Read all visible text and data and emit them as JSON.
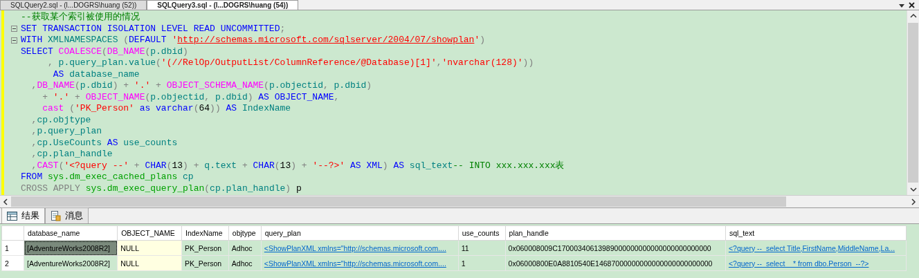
{
  "doc_tabs": [
    {
      "label": "SQLQuery2.sql - (l...DOGRS\\huang (52))",
      "selected": false
    },
    {
      "label": "SQLQuery3.sql - (l...DOGRS\\huang (54))",
      "selected": true
    }
  ],
  "editor": {
    "lines": [
      {
        "fold": false,
        "tokens": [
          {
            "kind": "comment",
            "text": "--获取某个索引被使用的情况"
          }
        ]
      },
      {
        "fold": true,
        "tokens": [
          {
            "kind": "keyword",
            "text": "SET TRANSACTION ISOLATION LEVEL READ UNCOMMITTED"
          },
          {
            "kind": "op",
            "text": ";"
          }
        ]
      },
      {
        "fold": true,
        "tokens": [
          {
            "kind": "keyword",
            "text": "WITH"
          },
          {
            "kind": "ident",
            "text": " XMLNAMESPACES "
          },
          {
            "kind": "op",
            "text": "("
          },
          {
            "kind": "keyword",
            "text": "DEFAULT "
          },
          {
            "kind": "string",
            "text": "'"
          },
          {
            "kind": "link",
            "text": "http://schemas.microsoft.com/sqlserver/2004/07/showplan"
          },
          {
            "kind": "string",
            "text": "'"
          },
          {
            "kind": "op",
            "text": ")"
          }
        ]
      },
      {
        "fold": false,
        "tokens": [
          {
            "kind": "keyword",
            "text": "SELECT "
          },
          {
            "kind": "function",
            "text": "COALESCE"
          },
          {
            "kind": "op",
            "text": "("
          },
          {
            "kind": "function",
            "text": "DB_NAME"
          },
          {
            "kind": "op",
            "text": "("
          },
          {
            "kind": "ident",
            "text": "p.dbid"
          },
          {
            "kind": "op",
            "text": ")"
          }
        ]
      },
      {
        "fold": false,
        "tokens": [
          {
            "kind": "op",
            "text": "     , "
          },
          {
            "kind": "ident",
            "text": "p.query_plan.value"
          },
          {
            "kind": "op",
            "text": "("
          },
          {
            "kind": "string",
            "text": "'(//RelOp/OutputList/ColumnReference/@Database)[1]'"
          },
          {
            "kind": "op",
            "text": ","
          },
          {
            "kind": "string",
            "text": "'nvarchar(128)'"
          },
          {
            "kind": "op",
            "text": "))"
          }
        ]
      },
      {
        "fold": false,
        "tokens": [
          {
            "kind": "keyword",
            "text": "      AS "
          },
          {
            "kind": "ident",
            "text": "database_name"
          }
        ]
      },
      {
        "fold": false,
        "tokens": [
          {
            "kind": "op",
            "text": "  ,"
          },
          {
            "kind": "function",
            "text": "DB_NAME"
          },
          {
            "kind": "op",
            "text": "("
          },
          {
            "kind": "ident",
            "text": "p.dbid"
          },
          {
            "kind": "op",
            "text": ") + "
          },
          {
            "kind": "string",
            "text": "'.'"
          },
          {
            "kind": "op",
            "text": " + "
          },
          {
            "kind": "function",
            "text": "OBJECT_SCHEMA_NAME"
          },
          {
            "kind": "op",
            "text": "("
          },
          {
            "kind": "ident",
            "text": "p.objectid"
          },
          {
            "kind": "op",
            "text": ", "
          },
          {
            "kind": "ident",
            "text": "p.dbid"
          },
          {
            "kind": "op",
            "text": ")"
          }
        ]
      },
      {
        "fold": false,
        "tokens": [
          {
            "kind": "op",
            "text": "    + "
          },
          {
            "kind": "string",
            "text": "'.'"
          },
          {
            "kind": "op",
            "text": " + "
          },
          {
            "kind": "function",
            "text": "OBJECT_NAME"
          },
          {
            "kind": "op",
            "text": "("
          },
          {
            "kind": "ident",
            "text": "p.objectid"
          },
          {
            "kind": "op",
            "text": ", "
          },
          {
            "kind": "ident",
            "text": "p.dbid"
          },
          {
            "kind": "op",
            "text": ") "
          },
          {
            "kind": "keyword",
            "text": "AS OBJECT_NAME"
          },
          {
            "kind": "op",
            "text": ","
          }
        ]
      },
      {
        "fold": false,
        "tokens": [
          {
            "kind": "function",
            "text": "    cast "
          },
          {
            "kind": "op",
            "text": "("
          },
          {
            "kind": "string",
            "text": "'PK_Person'"
          },
          {
            "kind": "keyword",
            "text": " as varchar"
          },
          {
            "kind": "op",
            "text": "("
          },
          {
            "kind": "plain",
            "text": "64"
          },
          {
            "kind": "op",
            "text": ")) "
          },
          {
            "kind": "keyword",
            "text": "AS "
          },
          {
            "kind": "ident",
            "text": "IndexName"
          }
        ]
      },
      {
        "fold": false,
        "tokens": [
          {
            "kind": "op",
            "text": "  ,"
          },
          {
            "kind": "ident",
            "text": "cp.objtype"
          }
        ]
      },
      {
        "fold": false,
        "tokens": [
          {
            "kind": "op",
            "text": "  ,"
          },
          {
            "kind": "ident",
            "text": "p.query_plan"
          }
        ]
      },
      {
        "fold": false,
        "tokens": [
          {
            "kind": "op",
            "text": "  ,"
          },
          {
            "kind": "ident",
            "text": "cp.UseCounts "
          },
          {
            "kind": "keyword",
            "text": "AS "
          },
          {
            "kind": "ident",
            "text": "use_counts"
          }
        ]
      },
      {
        "fold": false,
        "tokens": [
          {
            "kind": "op",
            "text": "  ,"
          },
          {
            "kind": "ident",
            "text": "cp.plan_handle"
          }
        ]
      },
      {
        "fold": false,
        "tokens": [
          {
            "kind": "op",
            "text": "  ,"
          },
          {
            "kind": "function",
            "text": "CAST"
          },
          {
            "kind": "op",
            "text": "("
          },
          {
            "kind": "string",
            "text": "'<?query --'"
          },
          {
            "kind": "op",
            "text": " + "
          },
          {
            "kind": "keyword",
            "text": "CHAR"
          },
          {
            "kind": "op",
            "text": "("
          },
          {
            "kind": "plain",
            "text": "13"
          },
          {
            "kind": "op",
            "text": ") + "
          },
          {
            "kind": "ident",
            "text": "q.text"
          },
          {
            "kind": "op",
            "text": " + "
          },
          {
            "kind": "keyword",
            "text": "CHAR"
          },
          {
            "kind": "op",
            "text": "("
          },
          {
            "kind": "plain",
            "text": "13"
          },
          {
            "kind": "op",
            "text": ") + "
          },
          {
            "kind": "string",
            "text": "'--?>'"
          },
          {
            "kind": "keyword",
            "text": " AS XML"
          },
          {
            "kind": "op",
            "text": ") "
          },
          {
            "kind": "keyword",
            "text": "AS "
          },
          {
            "kind": "ident",
            "text": "sql_text"
          },
          {
            "kind": "comment",
            "text": "-- INTO xxx.xxx.xxx表"
          }
        ]
      },
      {
        "fold": false,
        "tokens": [
          {
            "kind": "keyword",
            "text": "FROM "
          },
          {
            "kind": "system",
            "text": "sys.dm_exec_cached_plans"
          },
          {
            "kind": "ident",
            "text": " cp"
          }
        ]
      },
      {
        "fold": false,
        "tokens": [
          {
            "kind": "op",
            "text": "CROSS APPLY "
          },
          {
            "kind": "system",
            "text": "sys.dm_exec_query_plan"
          },
          {
            "kind": "op",
            "text": "("
          },
          {
            "kind": "ident",
            "text": "cp.plan_handle"
          },
          {
            "kind": "op",
            "text": ") "
          },
          {
            "kind": "plain",
            "text": "p"
          }
        ]
      }
    ]
  },
  "result_tabs": [
    {
      "label": "结果",
      "selected": true
    },
    {
      "label": "消息",
      "selected": false
    }
  ],
  "grid": {
    "columns": [
      "database_name",
      "OBJECT_NAME",
      "IndexName",
      "objtype",
      "query_plan",
      "use_counts",
      "plan_handle",
      "sql_text"
    ],
    "rows": [
      {
        "number": "1",
        "cells": [
          {
            "kind": "text",
            "text": "[AdventureWorks2008R2]",
            "selected": true
          },
          {
            "kind": "null",
            "text": "NULL",
            "selected": false
          },
          {
            "kind": "text",
            "text": "PK_Person",
            "selected": false
          },
          {
            "kind": "text",
            "text": "Adhoc",
            "selected": false
          },
          {
            "kind": "link",
            "text": "<ShowPlanXML xmlns=\"http://schemas.microsoft.com....",
            "selected": false
          },
          {
            "kind": "text",
            "text": "11",
            "selected": false
          },
          {
            "kind": "text",
            "text": "0x060008009C17000340613989000000000000000000000000",
            "selected": false
          },
          {
            "kind": "link",
            "text": "<?query --  select Title,FirstName,MiddleName,La...",
            "selected": false
          }
        ]
      },
      {
        "number": "2",
        "cells": [
          {
            "kind": "text",
            "text": "[AdventureWorks2008R2]",
            "selected": false
          },
          {
            "kind": "null",
            "text": "NULL",
            "selected": false
          },
          {
            "kind": "text",
            "text": "PK_Person",
            "selected": false
          },
          {
            "kind": "text",
            "text": "Adhoc",
            "selected": false
          },
          {
            "kind": "link",
            "text": "<ShowPlanXML xmlns=\"http://schemas.microsoft.com....",
            "selected": false
          },
          {
            "kind": "text",
            "text": "1",
            "selected": false
          },
          {
            "kind": "text",
            "text": "0x06000800E0A8810540E14687000000000000000000000000",
            "selected": false
          },
          {
            "kind": "link",
            "text": "<?query --  select    * from dbo.Person  --?>",
            "selected": false
          }
        ]
      }
    ]
  }
}
